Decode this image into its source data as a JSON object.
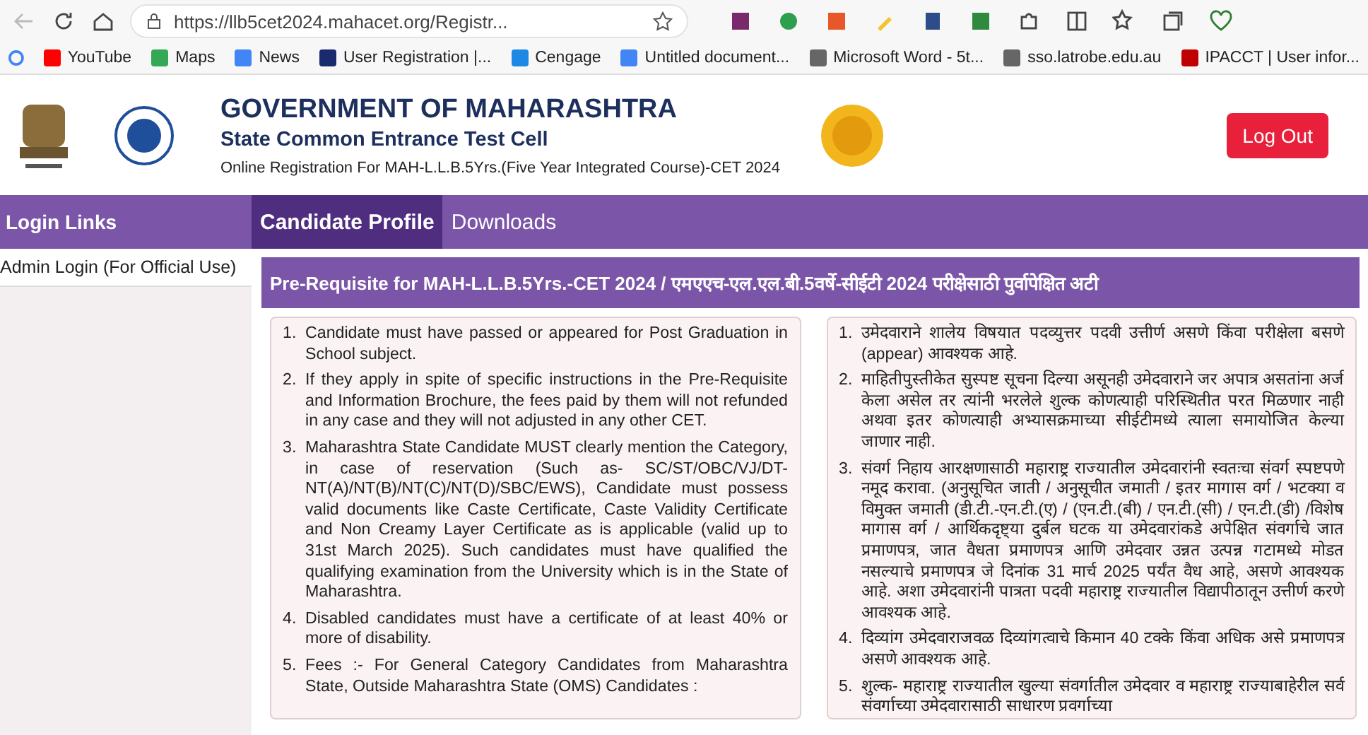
{
  "browser": {
    "url": "https://llb5cet2024.mahacet.org/Registr...",
    "bookmarks": [
      {
        "label": "YouTube",
        "color": "#ff0000"
      },
      {
        "label": "Maps",
        "color": "#34a853"
      },
      {
        "label": "News",
        "color": "#4285f4"
      },
      {
        "label": "User Registration |...",
        "color": "#1a2a6c"
      },
      {
        "label": "Cengage",
        "color": "#1e88e5"
      },
      {
        "label": "Untitled document...",
        "color": "#4285f4"
      },
      {
        "label": "Microsoft Word - 5t...",
        "color": "#666666"
      },
      {
        "label": "sso.latrobe.edu.au",
        "color": "#666666"
      },
      {
        "label": "IPACCT | User infor...",
        "color": "#c00000"
      }
    ]
  },
  "header": {
    "title": "GOVERNMENT OF MAHARASHTRA",
    "subtitle": "State Common Entrance Test Cell",
    "caption": "Online Registration For MAH-L.L.B.5Yrs.(Five Year Integrated Course)-CET 2024",
    "logout": "Log Out"
  },
  "nav": {
    "sidebar_title": "Login Links",
    "tabs": [
      {
        "label": "Candidate Profile",
        "selected": true
      },
      {
        "label": "Downloads",
        "selected": false
      }
    ]
  },
  "sidebar": {
    "items": [
      {
        "label": "Admin Login (For Official Use)",
        "selected": false
      }
    ]
  },
  "panel": {
    "title": "Pre-Requisite for MAH-L.L.B.5Yrs.-CET 2024 / एमएएच-एल.एल.बी.5वर्षे-सीईटी 2024 परीक्षेसाठी पुर्वापेक्षित अटी",
    "english": [
      {
        "number": "1.",
        "text": "Candidate must have passed or appeared for Post Graduation in School subject."
      },
      {
        "number": "2.",
        "text": "If they apply in spite of specific instructions in the Pre-Requisite and Information Brochure, the fees paid by them will not refunded in any case and they will not adjusted in any other CET."
      },
      {
        "number": "3.",
        "text": "Maharashtra State Candidate MUST clearly mention the Category, in case of reservation (Such as- SC/ST/OBC/VJ/DT-NT(A)/NT(B)/NT(C)/NT(D)/SBC/EWS), Candidate must possess valid documents like Caste Certificate, Caste Validity Certificate and Non Creamy Layer Certificate as is applicable (valid up to 31st March 2025). Such candidates must have qualified the qualifying examination from the University which is in the State of Maharashtra."
      },
      {
        "number": "4.",
        "text": "Disabled candidates must have a certificate of at least 40% or more of disability."
      },
      {
        "number": "5.",
        "text": "Fees :- For General Category Candidates from Maharashtra State, Outside Maharashtra State (OMS) Candidates :"
      }
    ],
    "marathi": [
      {
        "number": "1.",
        "text": "उमेदवाराने शालेय विषयात पदव्युत्तर पदवी उत्तीर्ण असणे किंवा परीक्षेला बसणे (appear) आवश्यक आहे."
      },
      {
        "number": "2.",
        "text": "माहितीपुस्तीकेत सुस्पष्ट सूचना दिल्या असूनही उमेदवाराने जर अपात्र असतांना अर्ज केला असेल तर त्यांनी भरलेले शुल्क कोणत्याही परिस्थितीत परत मिळणार नाही अथवा इतर कोणत्याही अभ्यासक्रमाच्या सीईटीमध्ये त्याला समायोजित केल्या जाणार नाही."
      },
      {
        "number": "3.",
        "text": "संवर्ग निहाय आरक्षणासाठी महाराष्ट्र राज्यातील उमेदवारांनी स्वतःचा संवर्ग स्पष्टपणे नमूद करावा. (अनुसूचित जाती / अनुसूचीत जमाती / इतर मागास वर्ग / भटक्या व विमुक्त जमाती (डी.टी.-एन.टी.(ए) / (एन.टी.(बी) / एन.टी.(सी) / एन.टी.(डी) /विशेष मागास वर्ग / आर्थिकदृष्ट्या दुर्बल घटक या उमेदवारांकडे अपेक्षित संवर्गाचे जात प्रमाणपत्र, जात वैधता प्रमाणपत्र आणि उमेदवार उन्नत उत्पन्न गटामध्ये मोडत नसल्याचे प्रमाणपत्र जे दिनांक 31 मार्च 2025 पर्यंत वैध आहे, असणे आवश्यक आहे. अशा उमेदवारांनी पात्रता पदवी महाराष्ट्र राज्यातील विद्यापीठातून उत्तीर्ण करणे आवश्यक आहे."
      },
      {
        "number": "4.",
        "text": "दिव्यांग उमेदवाराजवळ दिव्यांगत्वाचे किमान 40 टक्के किंवा अधिक असे प्रमाणपत्र असणे आवश्यक आहे."
      },
      {
        "number": "5.",
        "text": "शुल्क- महाराष्ट्र राज्यातील खुल्या संवर्गातील उमेदवार व महाराष्ट्र राज्याबाहेरील सर्व संवर्गाच्या उमेदवारासाठी साधारण प्रवर्गाच्या"
      }
    ]
  }
}
